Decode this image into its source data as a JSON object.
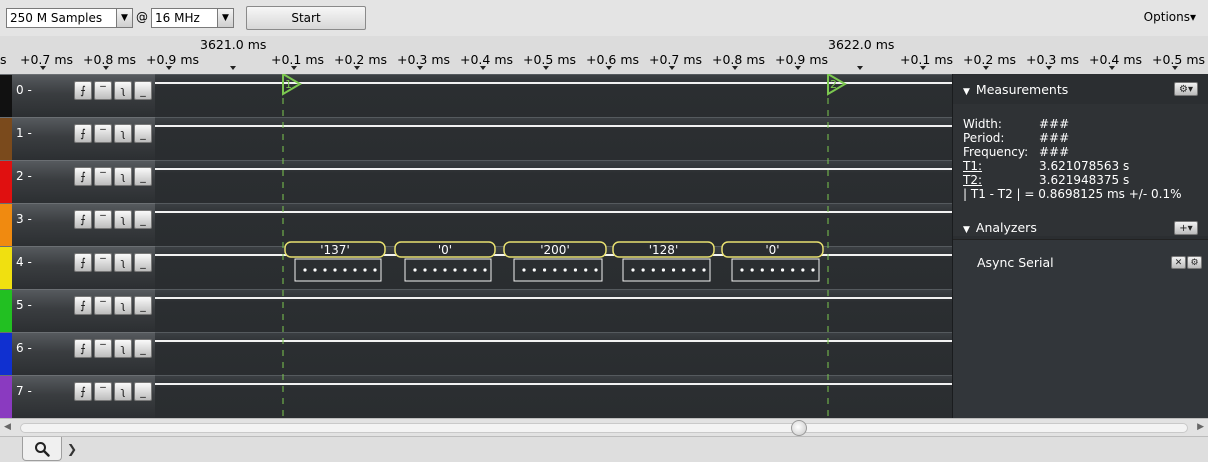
{
  "toolbar": {
    "samples_value": "250 M Samples",
    "at_symbol": "@",
    "rate_value": "16 MHz",
    "start_label": "Start",
    "options_label": "Options▾"
  },
  "ruler": {
    "major_left": "3621.0 ms",
    "major_right": "3622.0 ms",
    "labels": [
      "s",
      "+0.7 ms",
      "+0.8 ms",
      "+0.9 ms",
      "+0.1 ms",
      "+0.2 ms",
      "+0.3 ms",
      "+0.4 ms",
      "+0.5 ms",
      "+0.6 ms",
      "+0.7 ms",
      "+0.8 ms",
      "+0.9 ms",
      "+0.1 ms",
      "+0.2 ms",
      "+0.3 ms",
      "+0.4 ms",
      "+0.5 ms"
    ]
  },
  "channels": [
    {
      "label": "0 -",
      "color": "#111111"
    },
    {
      "label": "1 -",
      "color": "#7a4a1c"
    },
    {
      "label": "2 -",
      "color": "#e01010"
    },
    {
      "label": "3 -",
      "color": "#f08a10"
    },
    {
      "label": "4 -",
      "color": "#f0e010"
    },
    {
      "label": "5 -",
      "color": "#22c022"
    },
    {
      "label": "6 -",
      "color": "#1030d0"
    },
    {
      "label": "7 -",
      "color": "#8a3ac0"
    }
  ],
  "trigger_glyphs": [
    "⨍",
    "‾",
    "ʅ",
    "_"
  ],
  "cursors": {
    "t1_label": "1",
    "t2_label": "2",
    "color": "#7cc850"
  },
  "decoded": {
    "color": "#e8e070",
    "bytes": [
      "'137'",
      "'0'",
      "'200'",
      "'128'",
      "'0'"
    ],
    "bit_marker": "•"
  },
  "measurements": {
    "title": "Measurements",
    "width_label": "Width:",
    "width_value": "###",
    "period_label": "Period:",
    "period_value": "###",
    "frequency_label": "Frequency:",
    "frequency_value": "###",
    "t1_label": "T1:",
    "t1_value": "3.621078563 s",
    "t2_label": "T2:",
    "t2_value": "3.621948375 s",
    "diff_text": "| T1 - T2 | = 0.8698125 ms +/- 0.1%"
  },
  "analyzers": {
    "title": "Analyzers",
    "items": [
      "Async Serial"
    ]
  },
  "icons": {
    "gear": "gear-icon",
    "plus": "plus-icon",
    "close": "close-icon",
    "search": "search-icon"
  }
}
